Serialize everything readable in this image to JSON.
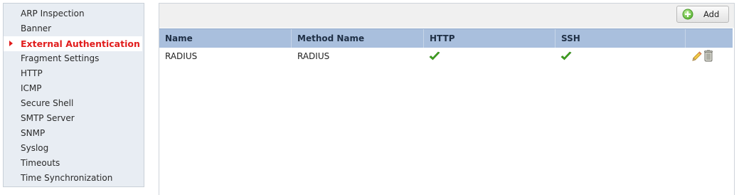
{
  "sidebar": {
    "items": [
      {
        "label": "ARP Inspection",
        "active": false
      },
      {
        "label": "Banner",
        "active": false
      },
      {
        "label": "External Authentication",
        "active": true
      },
      {
        "label": "Fragment Settings",
        "active": false
      },
      {
        "label": "HTTP",
        "active": false
      },
      {
        "label": "ICMP",
        "active": false
      },
      {
        "label": "Secure Shell",
        "active": false
      },
      {
        "label": "SMTP Server",
        "active": false
      },
      {
        "label": "SNMP",
        "active": false
      },
      {
        "label": "Syslog",
        "active": false
      },
      {
        "label": "Timeouts",
        "active": false
      },
      {
        "label": "Time Synchronization",
        "active": false
      }
    ]
  },
  "toolbar": {
    "add_label": "Add",
    "add_icon": "plus-circle-icon"
  },
  "table": {
    "columns": [
      "Name",
      "Method Name",
      "HTTP",
      "SSH",
      ""
    ],
    "rows": [
      {
        "name": "RADIUS",
        "method_name": "RADIUS",
        "http": "checkmark-icon",
        "ssh": "checkmark-icon",
        "actions": [
          "edit-pencil-icon",
          "delete-trash-icon"
        ]
      }
    ]
  },
  "colors": {
    "active_nav": "#e11d1d",
    "header_bg": "#a9bfdd",
    "sidebar_bg": "#e8edf3",
    "check_green": "#3fa51f"
  }
}
